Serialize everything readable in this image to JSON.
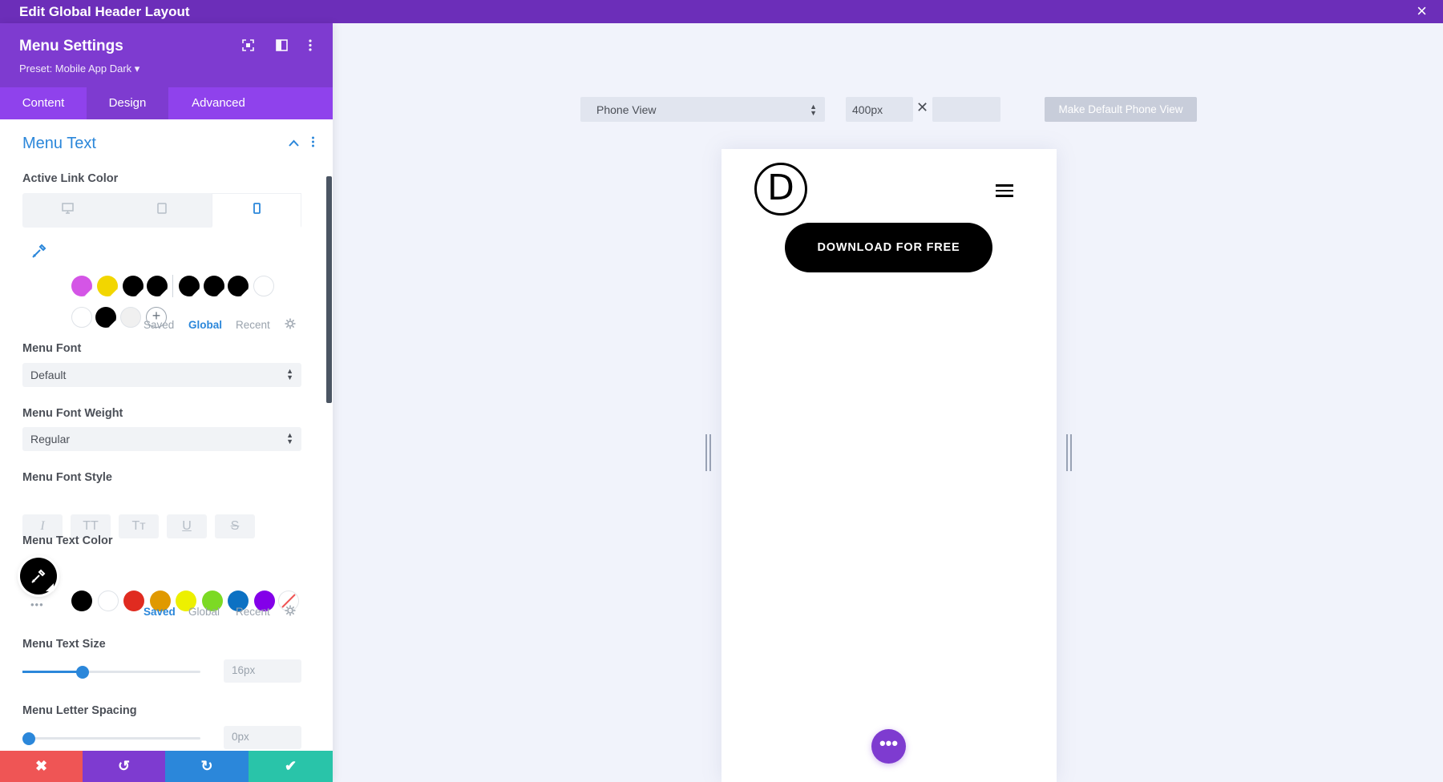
{
  "window": {
    "title": "Edit Global Header Layout",
    "close_icon": "×"
  },
  "panel": {
    "title": "Menu Settings",
    "preset": "Preset: Mobile App Dark ▾",
    "tabs": [
      {
        "label": "Content"
      },
      {
        "label": "Design"
      },
      {
        "label": "Advanced"
      }
    ],
    "section_title": "Menu Text",
    "active_link_color": {
      "label": "Active Link Color",
      "palette_tabs": [
        "Saved",
        "Global",
        "Recent"
      ],
      "active_palette": "Global",
      "swatches": [
        "#d455e6",
        "#f2d600",
        "#000000",
        "#000000",
        "#000000",
        "#000000",
        "#000000",
        "#ffffff",
        "#ffffff",
        "#000000",
        "#f0f0f0"
      ]
    },
    "menu_font": {
      "label": "Menu Font",
      "value": "Default"
    },
    "menu_font_weight": {
      "label": "Menu Font Weight",
      "value": "Regular"
    },
    "menu_font_style": {
      "label": "Menu Font Style",
      "buttons": [
        "I",
        "TT",
        "Tт",
        "U",
        "S"
      ]
    },
    "menu_text_color": {
      "label": "Menu Text Color",
      "palette_tabs": [
        "Saved",
        "Global",
        "Recent"
      ],
      "active_palette": "Saved",
      "swatches": [
        "#000000",
        "#ffffff",
        "#e02b20",
        "#e09900",
        "#edf000",
        "#7cda24",
        "#0c71c3",
        "#8300e9"
      ]
    },
    "menu_text_size": {
      "label": "Menu Text Size",
      "value": "16px",
      "slider_fraction": 0.34
    },
    "menu_letter_spacing": {
      "label": "Menu Letter Spacing",
      "value": "0px",
      "slider_fraction": 0.0
    },
    "actions": {
      "cancel_icon": "✖",
      "undo_icon": "↺",
      "redo_icon": "↻",
      "save_icon": "✔"
    },
    "colors": {
      "cancel": "#ef5555",
      "undo": "#7e3bd0",
      "redo": "#2b87da",
      "save": "#29c4a9"
    }
  },
  "canvas": {
    "view_select": "Phone View",
    "width_value": "400px",
    "height_value": "",
    "times_sign": "✕",
    "make_default": "Make Default Phone View",
    "logo_letter": "D",
    "download_button": "DOWNLOAD FOR FREE",
    "fab_label": "•••"
  }
}
